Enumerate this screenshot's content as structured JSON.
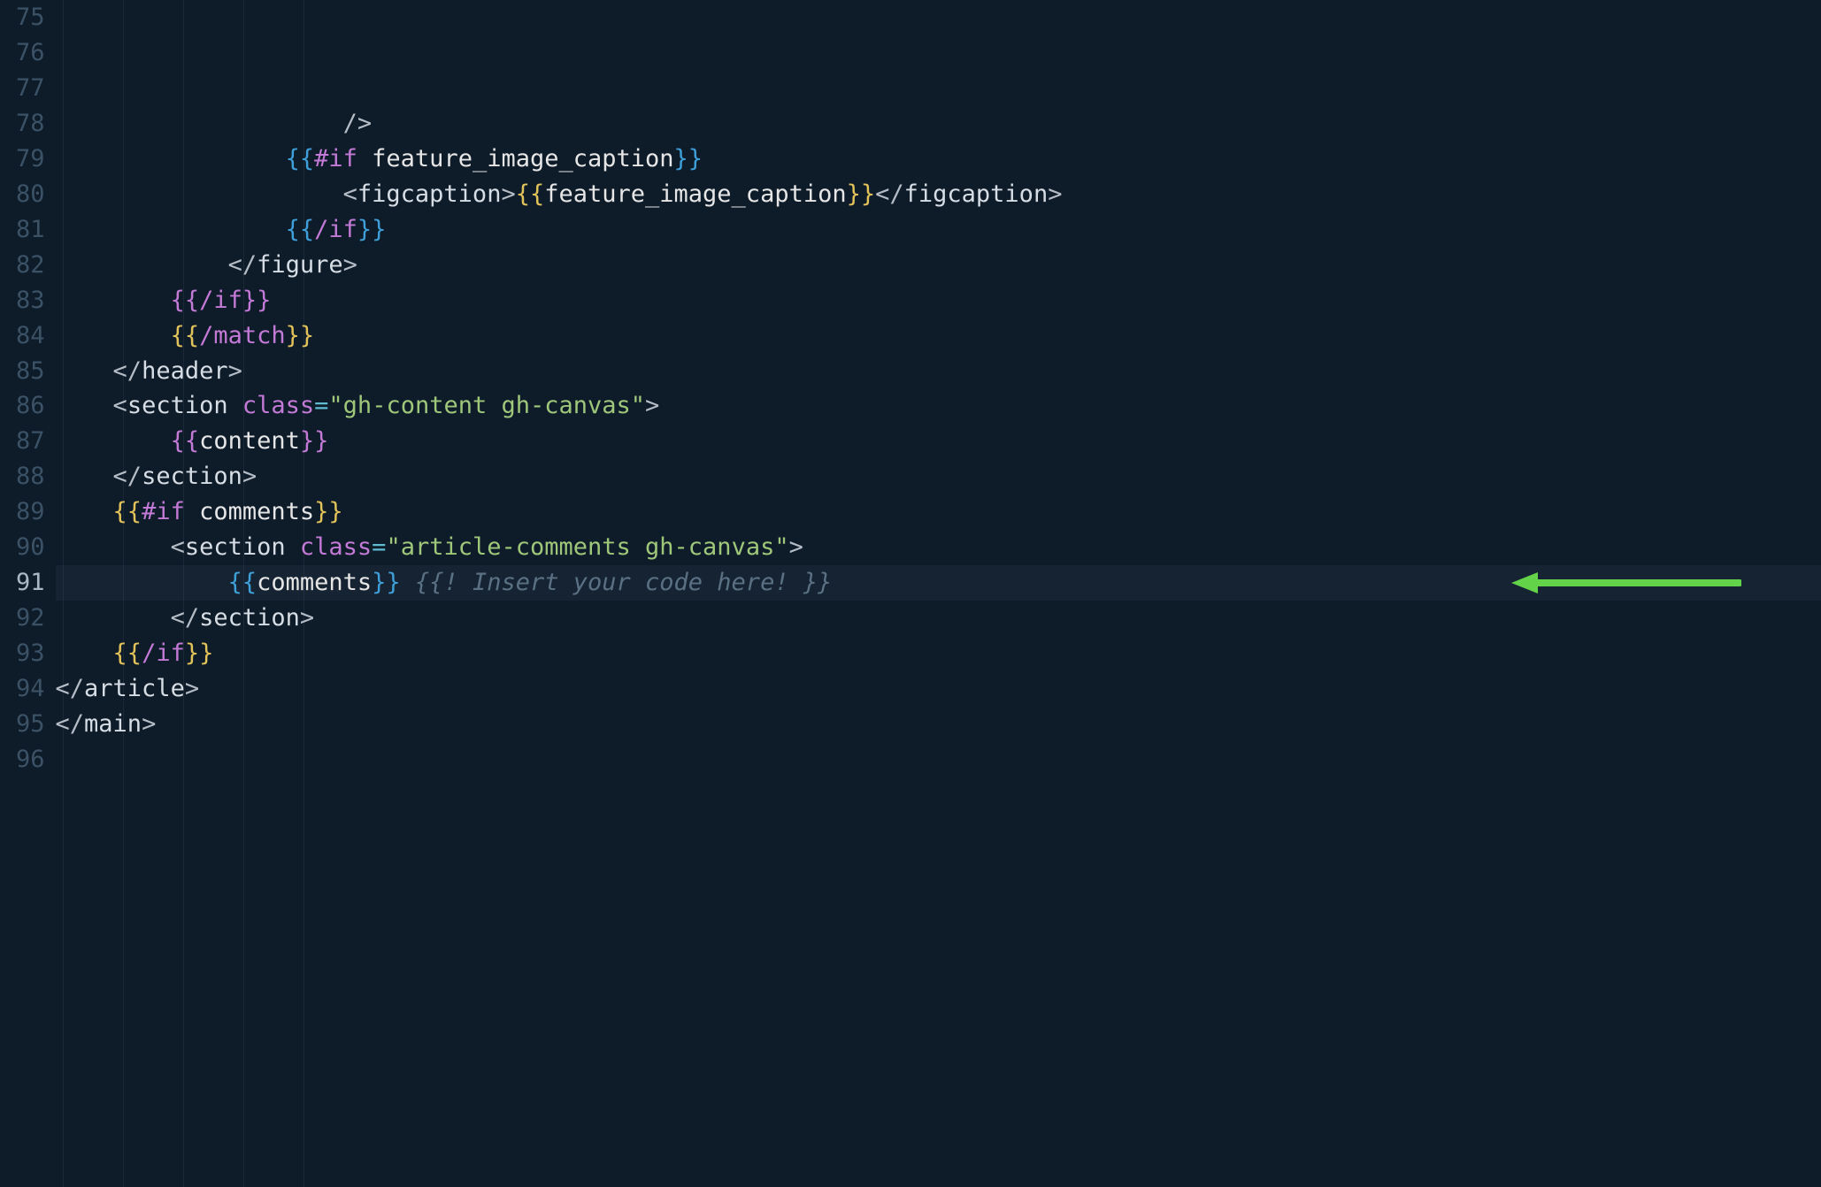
{
  "gutter": {
    "start": 75,
    "end": 96,
    "current": 91
  },
  "lines": [
    {
      "n": 75,
      "indent": 20,
      "tokens": [
        {
          "t": "angle",
          "v": "/>"
        }
      ]
    },
    {
      "n": 76,
      "indent": 16,
      "tokens": [
        {
          "t": "br-blue",
          "v": "{{"
        },
        {
          "t": "kw-hbs",
          "v": "#if"
        },
        {
          "t": "ident",
          "v": " feature_image_caption"
        },
        {
          "t": "br-blue",
          "v": "}}"
        }
      ]
    },
    {
      "n": 77,
      "indent": 20,
      "tokens": [
        {
          "t": "angle",
          "v": "<"
        },
        {
          "t": "tag",
          "v": "figcaption"
        },
        {
          "t": "angle",
          "v": ">"
        },
        {
          "t": "br-yellow",
          "v": "{{"
        },
        {
          "t": "ident",
          "v": "feature_image_caption"
        },
        {
          "t": "br-yellow",
          "v": "}}"
        },
        {
          "t": "angle",
          "v": "</"
        },
        {
          "t": "tag",
          "v": "figcaption"
        },
        {
          "t": "angle",
          "v": ">"
        }
      ]
    },
    {
      "n": 78,
      "indent": 16,
      "tokens": [
        {
          "t": "br-blue",
          "v": "{{"
        },
        {
          "t": "kw-hbs",
          "v": "/if"
        },
        {
          "t": "br-blue",
          "v": "}}"
        }
      ]
    },
    {
      "n": 79,
      "indent": 12,
      "tokens": [
        {
          "t": "angle",
          "v": "</"
        },
        {
          "t": "tag",
          "v": "figure"
        },
        {
          "t": "angle",
          "v": ">"
        }
      ]
    },
    {
      "n": 80,
      "indent": 8,
      "tokens": [
        {
          "t": "br-purple",
          "v": "{{"
        },
        {
          "t": "kw-hbs",
          "v": "/if"
        },
        {
          "t": "br-purple",
          "v": "}}"
        }
      ]
    },
    {
      "n": 81,
      "indent": 8,
      "tokens": [
        {
          "t": "br-yellow",
          "v": "{{"
        },
        {
          "t": "kw-hbs",
          "v": "/match"
        },
        {
          "t": "br-yellow",
          "v": "}}"
        }
      ]
    },
    {
      "n": 82,
      "indent": 0,
      "tokens": []
    },
    {
      "n": 83,
      "indent": 4,
      "tokens": [
        {
          "t": "angle",
          "v": "</"
        },
        {
          "t": "tag",
          "v": "header"
        },
        {
          "t": "angle",
          "v": ">"
        }
      ]
    },
    {
      "n": 84,
      "indent": 0,
      "tokens": []
    },
    {
      "n": 85,
      "indent": 4,
      "tokens": [
        {
          "t": "angle",
          "v": "<"
        },
        {
          "t": "tag",
          "v": "section"
        },
        {
          "t": "ident",
          "v": " "
        },
        {
          "t": "attr",
          "v": "class"
        },
        {
          "t": "eq",
          "v": "="
        },
        {
          "t": "str",
          "v": "\"gh-content gh-canvas\""
        },
        {
          "t": "angle",
          "v": ">"
        }
      ]
    },
    {
      "n": 86,
      "indent": 8,
      "tokens": [
        {
          "t": "br-purple",
          "v": "{{"
        },
        {
          "t": "ident",
          "v": "content"
        },
        {
          "t": "br-purple",
          "v": "}}"
        }
      ]
    },
    {
      "n": 87,
      "indent": 4,
      "tokens": [
        {
          "t": "angle",
          "v": "</"
        },
        {
          "t": "tag",
          "v": "section"
        },
        {
          "t": "angle",
          "v": ">"
        }
      ]
    },
    {
      "n": 88,
      "indent": 0,
      "tokens": []
    },
    {
      "n": 89,
      "indent": 4,
      "tokens": [
        {
          "t": "br-yellow",
          "v": "{{"
        },
        {
          "t": "kw-hbs",
          "v": "#if"
        },
        {
          "t": "ident",
          "v": " comments"
        },
        {
          "t": "br-yellow",
          "v": "}}"
        }
      ]
    },
    {
      "n": 90,
      "indent": 8,
      "tokens": [
        {
          "t": "angle",
          "v": "<"
        },
        {
          "t": "tag",
          "v": "section"
        },
        {
          "t": "ident",
          "v": " "
        },
        {
          "t": "attr",
          "v": "class"
        },
        {
          "t": "eq",
          "v": "="
        },
        {
          "t": "str",
          "v": "\"article-comments gh-canvas\""
        },
        {
          "t": "angle",
          "v": ">"
        }
      ]
    },
    {
      "n": 91,
      "indent": 12,
      "tokens": [
        {
          "t": "br-blue",
          "v": "{{"
        },
        {
          "t": "ident",
          "v": "comments"
        },
        {
          "t": "br-blue",
          "v": "}}"
        },
        {
          "t": "ident",
          "v": " "
        },
        {
          "t": "comment",
          "v": "{{! Insert your code here! }}"
        }
      ]
    },
    {
      "n": 92,
      "indent": 8,
      "tokens": [
        {
          "t": "angle",
          "v": "</"
        },
        {
          "t": "tag",
          "v": "section"
        },
        {
          "t": "angle",
          "v": ">"
        }
      ]
    },
    {
      "n": 93,
      "indent": 4,
      "tokens": [
        {
          "t": "br-yellow",
          "v": "{{"
        },
        {
          "t": "kw-hbs",
          "v": "/if"
        },
        {
          "t": "br-yellow",
          "v": "}}"
        }
      ]
    },
    {
      "n": 94,
      "indent": 0,
      "tokens": []
    },
    {
      "n": 95,
      "indent": 0,
      "tokens": [
        {
          "t": "angle",
          "v": "</"
        },
        {
          "t": "tag",
          "v": "article"
        },
        {
          "t": "angle",
          "v": ">"
        }
      ]
    },
    {
      "n": 96,
      "indent": 0,
      "tokens": [
        {
          "t": "angle",
          "v": "</"
        },
        {
          "t": "tag",
          "v": "main"
        },
        {
          "t": "angle",
          "v": ">"
        }
      ]
    }
  ],
  "arrow": {
    "color": "#63d44a"
  }
}
